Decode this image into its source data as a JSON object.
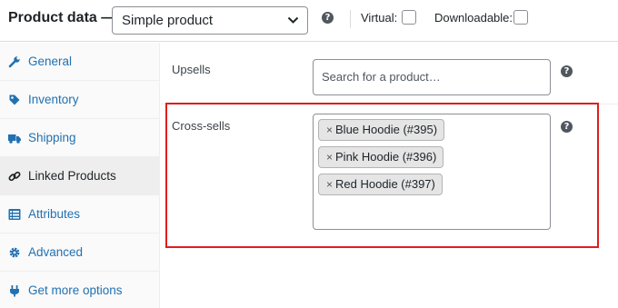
{
  "header": {
    "title": "Product data —",
    "product_type": "Simple product",
    "virtual_label": "Virtual:",
    "virtual_checked": false,
    "downloadable_label": "Downloadable:",
    "downloadable_checked": false,
    "help_glyph": "?"
  },
  "sidebar": {
    "items": [
      {
        "label": "General",
        "icon": "wrench-icon",
        "active": false
      },
      {
        "label": "Inventory",
        "icon": "tag-icon",
        "active": false
      },
      {
        "label": "Shipping",
        "icon": "truck-icon",
        "active": false
      },
      {
        "label": "Linked Products",
        "icon": "link-icon",
        "active": true
      },
      {
        "label": "Attributes",
        "icon": "list-icon",
        "active": false
      },
      {
        "label": "Advanced",
        "icon": "gear-icon",
        "active": false
      },
      {
        "label": "Get more options",
        "icon": "plugin-icon",
        "active": false
      }
    ]
  },
  "linked": {
    "upsells_label": "Upsells",
    "upsells_placeholder": "Search for a product…",
    "crosssells_label": "Cross-sells",
    "remove_glyph": "×",
    "crosssells": [
      "Blue Hoodie (#395)",
      "Pink Hoodie (#396)",
      "Red Hoodie (#397)"
    ]
  },
  "colors": {
    "link": "#2271b1",
    "text": "#1d2327",
    "highlight": "#e11d1d",
    "sidebar_bg": "#fafafa",
    "active_tab_bg": "#eeeeee"
  }
}
